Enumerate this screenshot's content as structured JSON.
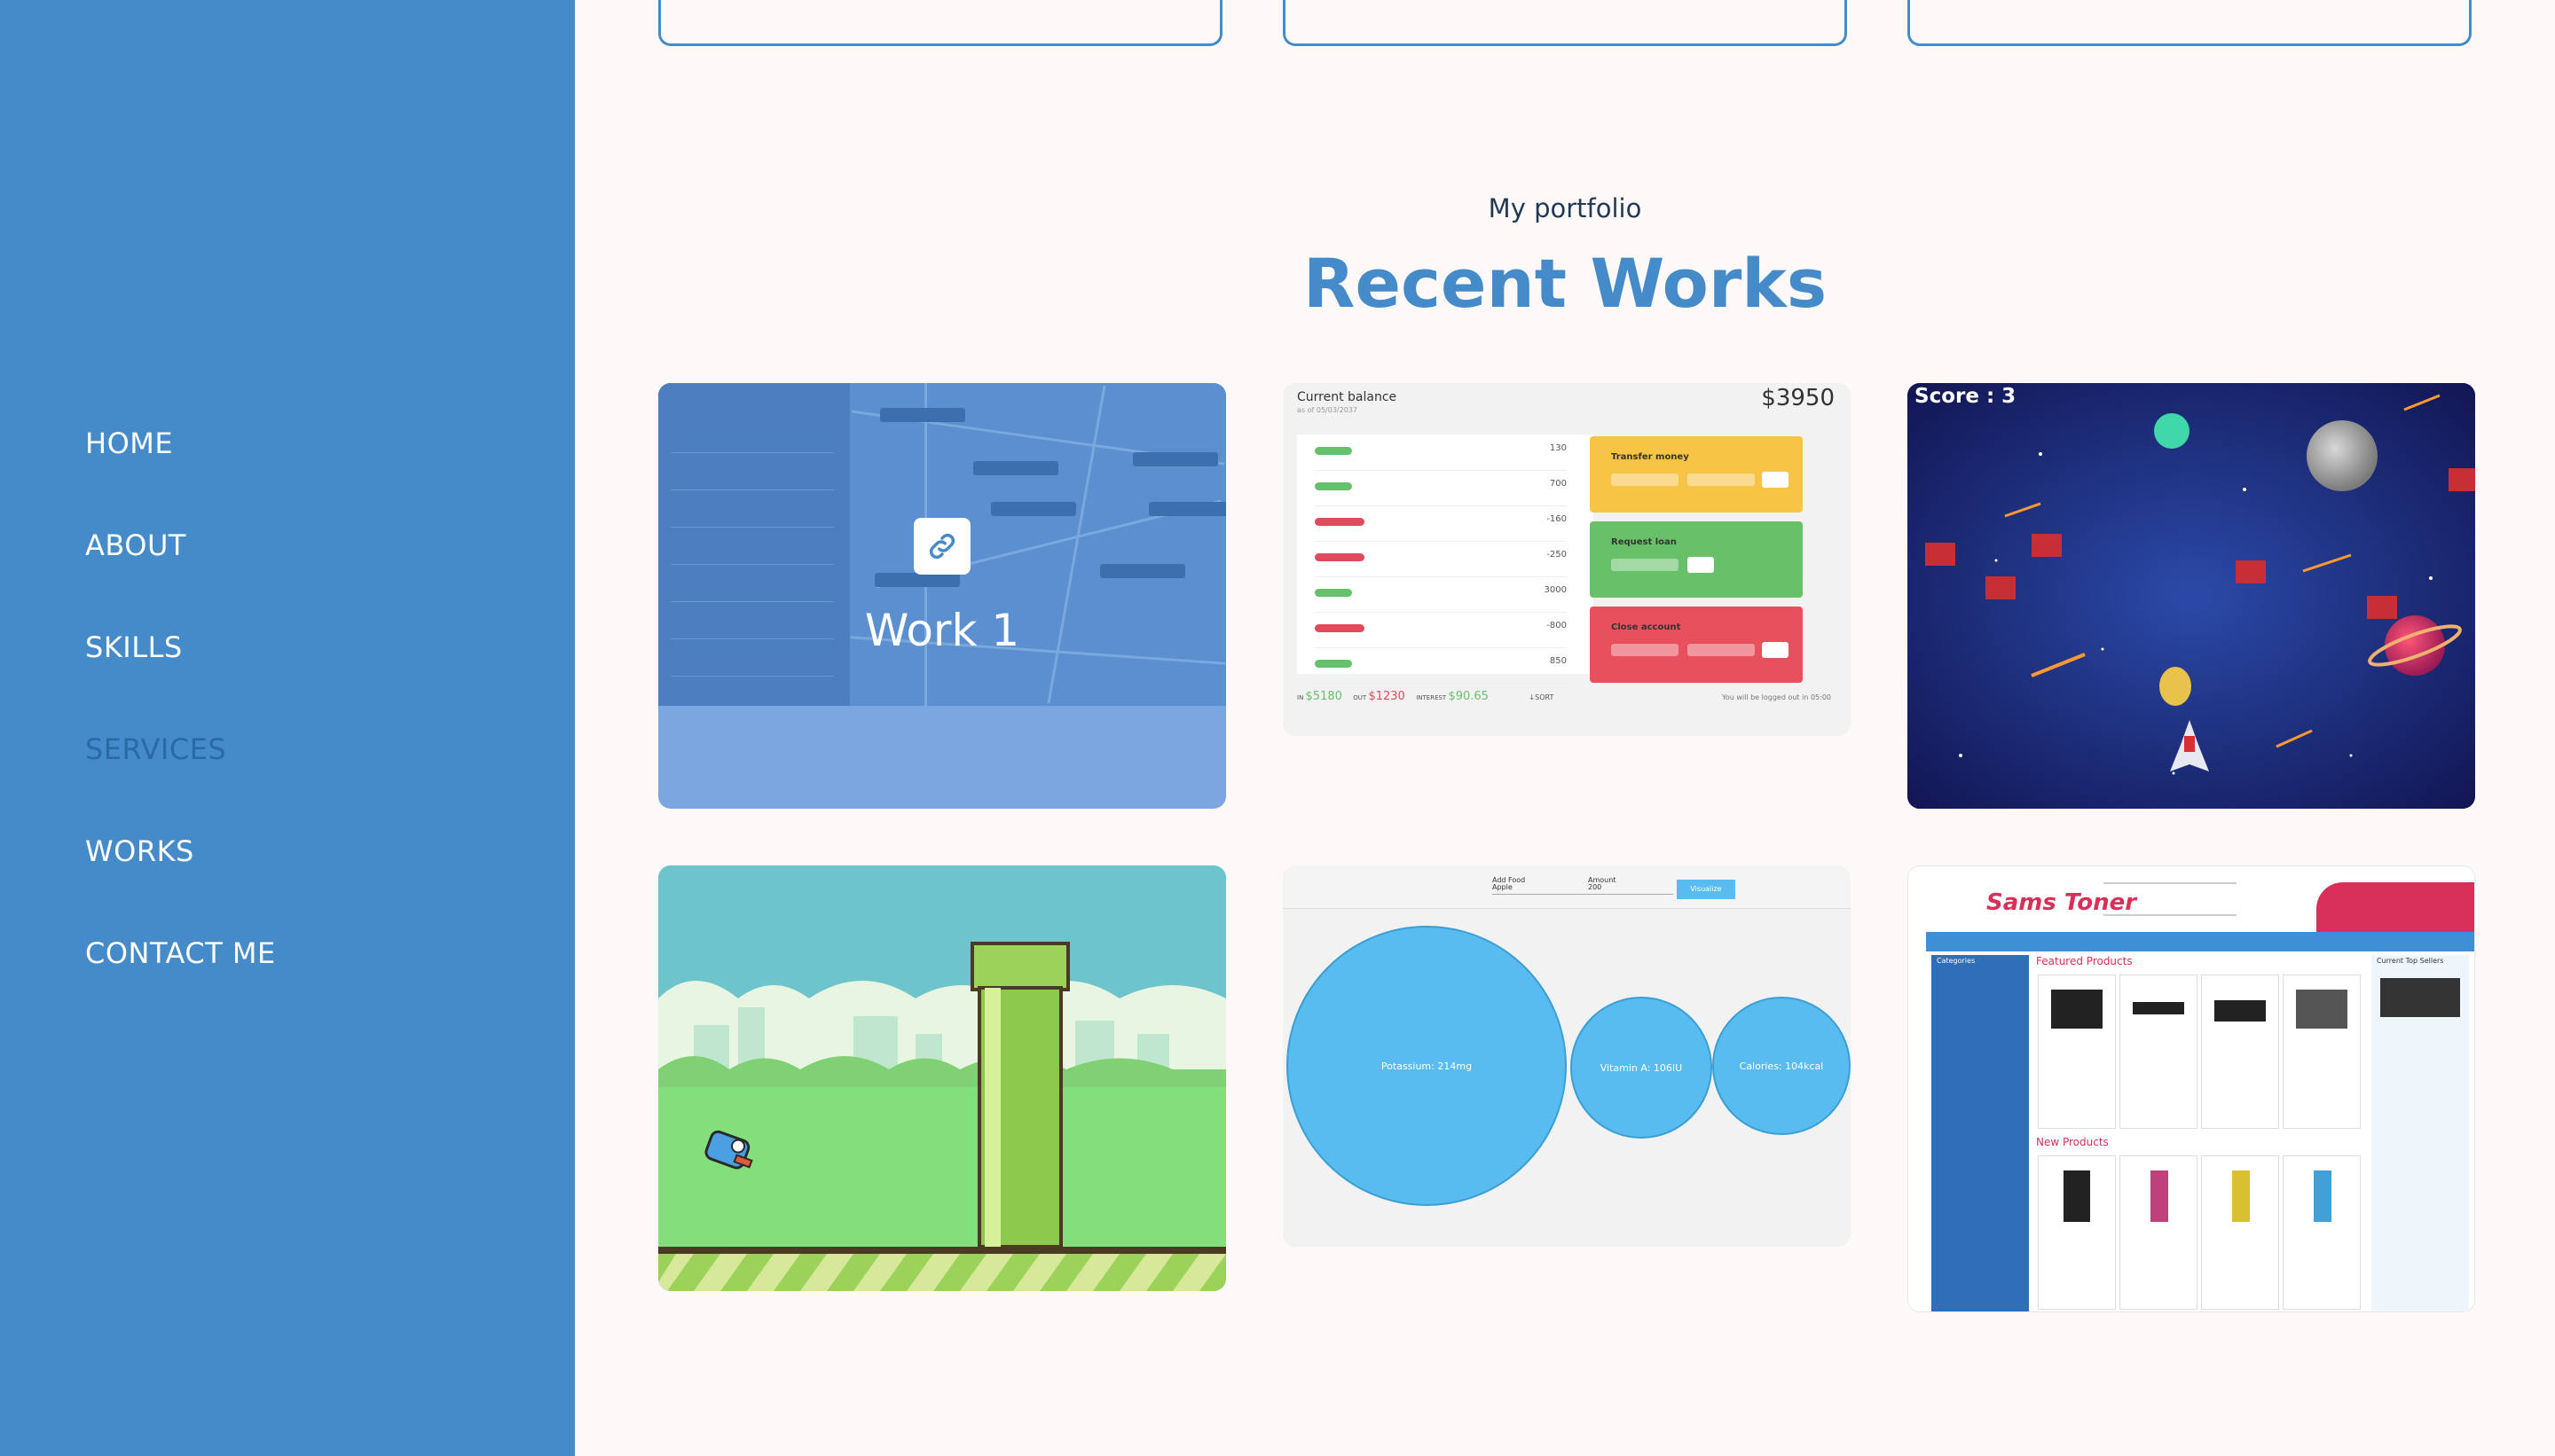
{
  "nav": {
    "items": [
      "HOME",
      "ABOUT",
      "SKILLS",
      "SERVICES",
      "WORKS",
      "CONTACT ME"
    ],
    "active": "SERVICES"
  },
  "portfolio": {
    "subtitle": "My portfolio",
    "title": "Recent Works"
  },
  "works": [
    {
      "label": "Work 1",
      "icon": "link-icon"
    },
    {
      "balance_label": "Current balance",
      "balance": "$3950",
      "operations": [
        "Transfer money",
        "Request loan",
        "Close account"
      ],
      "movements": [
        "130",
        "700",
        "-160",
        "-250",
        "3000",
        "-800",
        "850"
      ],
      "summary_in": "$5180",
      "summary_out": "$1230",
      "summary_interest": "$90.65",
      "sort": "↓SORT"
    },
    {
      "score": "Score : 3"
    },
    {},
    {
      "circles": [
        "Potassium: 214mg",
        "Vitamin A: 106IU",
        "Calories: 104kcal"
      ],
      "add_food_label": "Add Food",
      "food_value": "Apple",
      "amount_label": "Amount",
      "amount_value": "200",
      "visualize": "Visualize"
    },
    {
      "logo": "Sams Toner",
      "featured": "Featured Products",
      "new_products": "New Products",
      "top_sellers": "Current Top Sellers",
      "categories": "Categories"
    }
  ],
  "colors": {
    "sidebar": "#458bc9",
    "accent": "#458bc9",
    "page_bg": "#fdf9f8",
    "active_nav": "#2a6aa6"
  }
}
